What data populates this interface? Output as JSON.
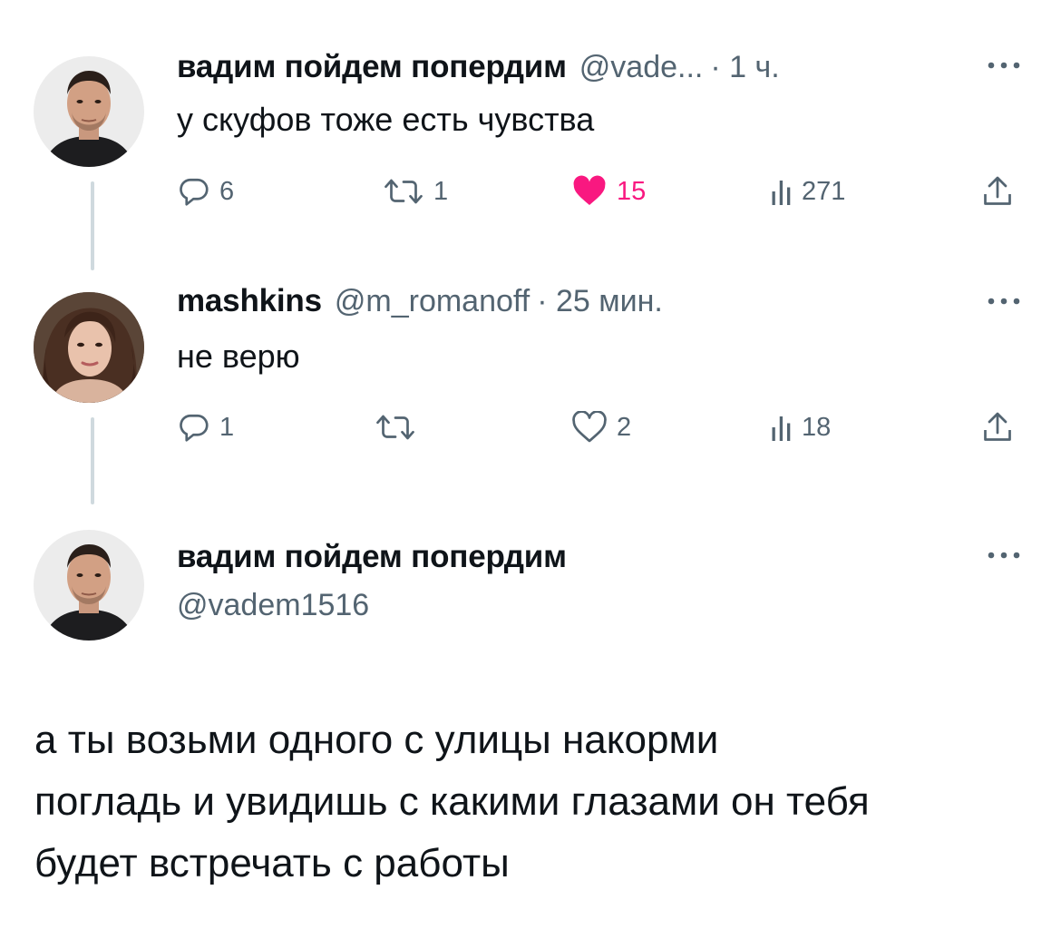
{
  "tweets": [
    {
      "display_name": "вадим пойдем попердим",
      "handle": "@vade...",
      "time": "· 1 ч.",
      "text": "у скуфов тоже есть чувства",
      "replies": "6",
      "retweets": "1",
      "likes": "15",
      "views": "271",
      "liked": true
    },
    {
      "display_name": "mashkins",
      "handle": "@m_romanoff",
      "time": "· 25 мин.",
      "text": "не верю",
      "replies": "1",
      "retweets": "",
      "likes": "2",
      "views": "18",
      "liked": false
    }
  ],
  "focus_tweet": {
    "display_name": "вадим пойдем попердим",
    "handle": "@vadem1516",
    "text_lines": [
      "а ты возьми одного с улицы накорми",
      "погладь и увидишь с какими глазами он тебя",
      "будет встречать с работы"
    ]
  },
  "colors": {
    "text": "#0f1419",
    "secondary": "#536471",
    "like": "#f91880",
    "thread_line": "#cfd9de"
  },
  "icons": [
    "reply-icon",
    "retweet-icon",
    "like-icon",
    "views-icon",
    "share-icon",
    "more-icon"
  ]
}
